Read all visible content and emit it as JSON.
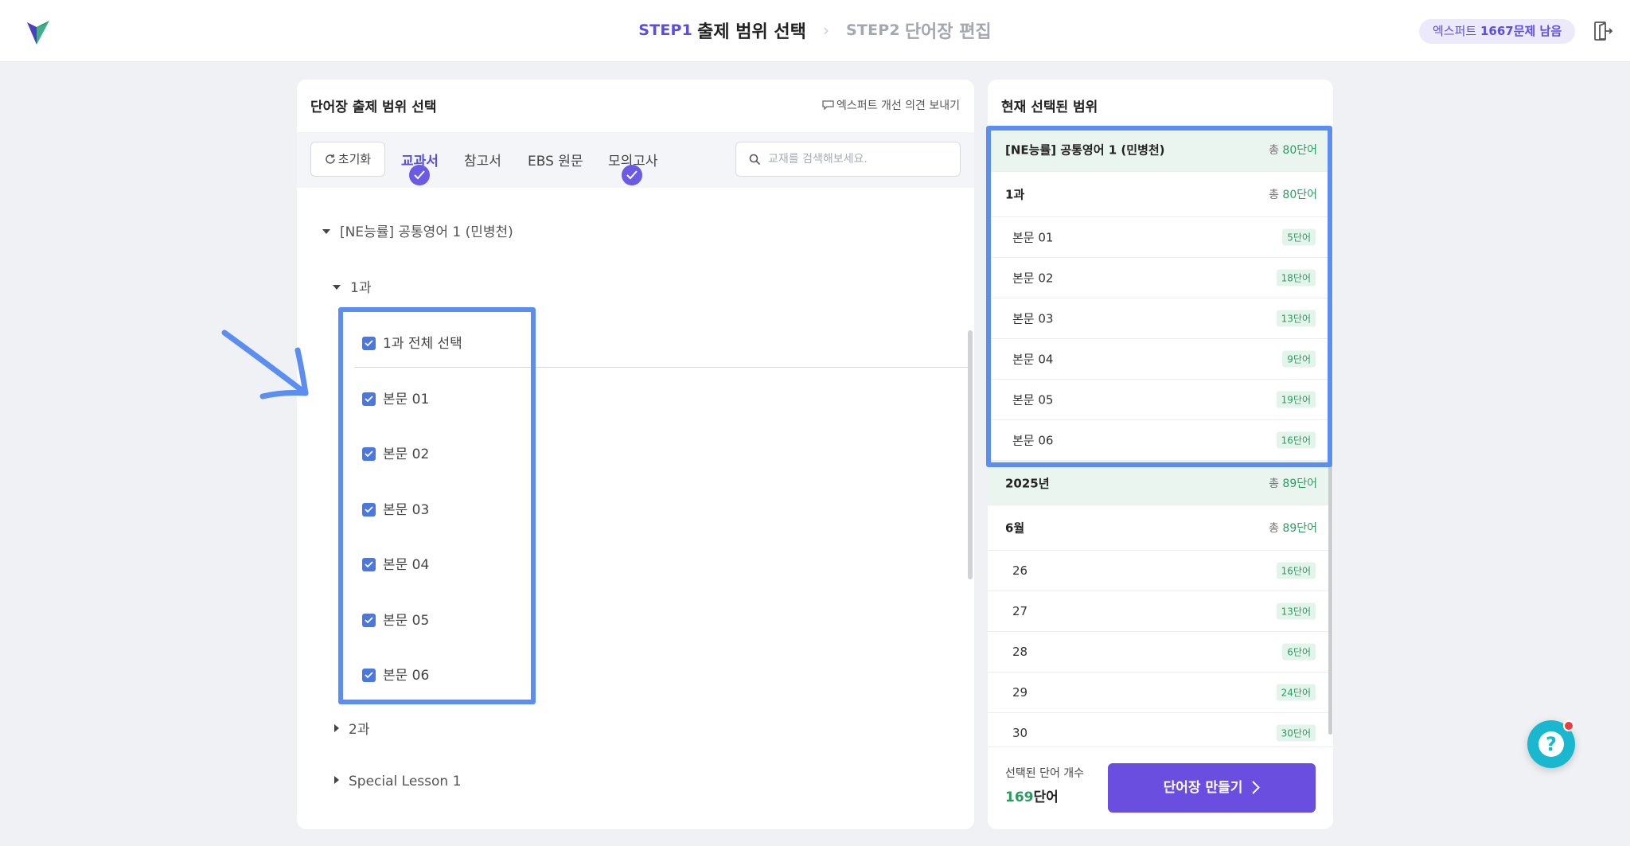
{
  "header": {
    "step1_tag": "STEP1",
    "step1_title": "출제 범위 선택",
    "step2_tag": "STEP2",
    "step2_title": "단어장 편집",
    "remaining_prefix": "엑스퍼트 ",
    "remaining_value": "1667문제 남음"
  },
  "left_panel": {
    "title": "단어장 출제 범위 선택",
    "feedback_label": "엑스퍼트 개선 의견 보내기",
    "reset_label": "초기화",
    "tabs": [
      {
        "label": "교과서",
        "active": true,
        "checked": true
      },
      {
        "label": "참고서",
        "active": false,
        "checked": false
      },
      {
        "label": "EBS 원문",
        "active": false,
        "checked": false
      },
      {
        "label": "모의고사",
        "active": false,
        "checked": true
      }
    ],
    "search_placeholder": "교재를 검색해보세요.",
    "tree": {
      "book": "[NE능률] 공통영어 1 (민병천)",
      "lesson_open": "1과",
      "select_all": "1과 전체 선택",
      "items": [
        "본문 01",
        "본문 02",
        "본문 03",
        "본문 04",
        "본문 05",
        "본문 06"
      ],
      "lesson2": "2과",
      "special": "Special Lesson 1"
    }
  },
  "right_panel": {
    "title": "현재 선택된 범위",
    "groups": [
      {
        "name": "[NE능률] 공통영어 1 (민병천)",
        "total_prefix": "총 ",
        "total": "80단어",
        "lessons": [
          {
            "name": "1과",
            "total_prefix": "총 ",
            "total": "80단어",
            "items": [
              {
                "name": "본문 01",
                "count": "5단어"
              },
              {
                "name": "본문 02",
                "count": "18단어"
              },
              {
                "name": "본문 03",
                "count": "13단어"
              },
              {
                "name": "본문 04",
                "count": "9단어"
              },
              {
                "name": "본문 05",
                "count": "19단어"
              },
              {
                "name": "본문 06",
                "count": "16단어"
              }
            ]
          }
        ]
      },
      {
        "name": "2025년",
        "total_prefix": "총 ",
        "total": "89단어",
        "lessons": [
          {
            "name": "6월",
            "total_prefix": "총 ",
            "total": "89단어",
            "items": [
              {
                "name": "26",
                "count": "16단어"
              },
              {
                "name": "27",
                "count": "13단어"
              },
              {
                "name": "28",
                "count": "6단어"
              },
              {
                "name": "29",
                "count": "24단어"
              },
              {
                "name": "30",
                "count": "30단어"
              }
            ]
          }
        ]
      }
    ],
    "selected_label": "선택된 단어 개수",
    "selected_count": "169",
    "selected_unit": "단어",
    "make_button": "단어장 만들기"
  },
  "colors": {
    "brand": "#5b4de0",
    "button": "#6a4ee0",
    "checkbox": "#4a78e0",
    "green": "#2e9a63",
    "annotation": "#5b8ef0",
    "help": "#19b8cf"
  }
}
